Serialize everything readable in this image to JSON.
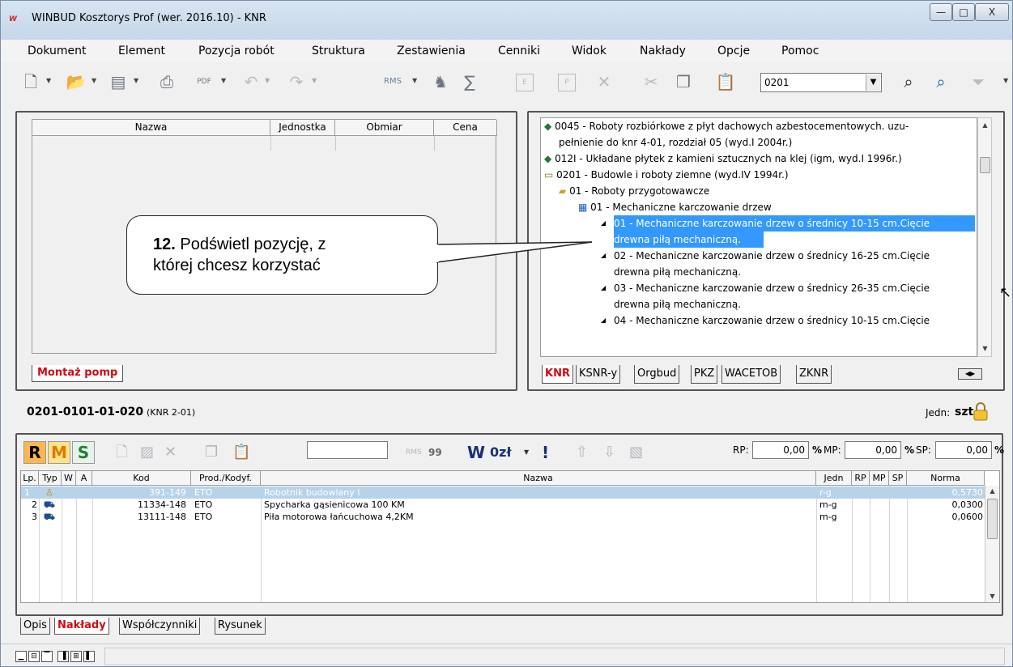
{
  "window": {
    "title": "WINBUD Kosztorys Prof (wer. 2016.10) - KNR",
    "app_icon_letter": "W",
    "min_glyph": "—",
    "max_glyph": "□",
    "close_glyph": "X"
  },
  "menu": [
    {
      "label": "Dokument"
    },
    {
      "label": "Element"
    },
    {
      "label": "Pozycja robót"
    },
    {
      "label": "Struktura"
    },
    {
      "label": "Zestawienia"
    },
    {
      "label": "Cenniki"
    },
    {
      "label": "Widok"
    },
    {
      "label": "Nakłady"
    },
    {
      "label": "Opcje"
    },
    {
      "label": "Pomoc"
    }
  ],
  "toolbar": {
    "code_value": "0201",
    "rms_label": "RMS",
    "pdf_label": "PDF",
    "e_label": "E",
    "p_label": "P"
  },
  "left_panel": {
    "columns": [
      "Nazwa",
      "Jednostka",
      "Obmiar",
      "Cena"
    ],
    "tab_label": "Montaż pomp"
  },
  "tree": {
    "items": [
      {
        "text": "0045 - Roboty rozbiórkowe z płyt dachowych azbestocementowych. uzu-"
      },
      {
        "text": "pełnienie do knr 4-01, rozdział 05 (wyd.I 2004r.)"
      },
      {
        "text": "012I - Układane płytek z kamieni sztucznych na klej (igm, wyd.I 1996r.)"
      },
      {
        "text": "0201 - Budowle i roboty ziemne (wyd.IV 1994r.)"
      },
      {
        "text": "01 - Roboty przygotowawcze"
      },
      {
        "text": "01 - Mechaniczne karczowanie drzew"
      },
      {
        "text": "01 - Mechaniczne karczowanie drzew o średnicy 10-15 cm.Cięcie"
      },
      {
        "text": "drewna piłą mechaniczną."
      },
      {
        "text": "02 - Mechaniczne karczowanie drzew o średnicy 16-25 cm.Cięcie"
      },
      {
        "text": "drewna piłą mechaniczną."
      },
      {
        "text": "03 - Mechaniczne karczowanie drzew o średnicy 26-35 cm.Cięcie"
      },
      {
        "text": "drewna piłą mechaniczną."
      },
      {
        "text": "04 - Mechaniczne karczowanie drzew o średnicy 10-15 cm.Cięcie"
      }
    ],
    "tabs": [
      "KNR",
      "KSNR-y",
      "Orgbud",
      "PKZ",
      "WACETOB",
      "ZKNR"
    ]
  },
  "position": {
    "code": "0201-0101-01-020",
    "catalog": "(KNR 2-01)",
    "unit_label": "Jedn:",
    "unit_value": "szt"
  },
  "bottom_toolbar": {
    "r_label": "R",
    "m_label": "M",
    "s_label": "S",
    "rms_small": "RMS",
    "num_99": "99",
    "w_label": "W",
    "zl_label": "0zł",
    "excl": "!",
    "rp_label": "RP:",
    "rp_value": "0,00",
    "mp_label": "MP:",
    "mp_value": "0,00",
    "sp_label": "SP:",
    "sp_value": "0,00",
    "pct": "%"
  },
  "grid": {
    "columns": [
      "Lp.",
      "Typ",
      "W",
      "A",
      "Kod",
      "Prod./Kodyf.",
      "Nazwa",
      "Jedn",
      "RP",
      "MP",
      "SP",
      "Norma"
    ],
    "rows": [
      {
        "lp": "1",
        "kod": "391-149",
        "prod": "ETO",
        "nazwa": "Robotnik budowlany I",
        "jedn": "r-g",
        "norma": "0,5730"
      },
      {
        "lp": "2",
        "kod": "11334-148",
        "prod": "ETO",
        "nazwa": "Spycharka gąsienicowa 100 KM",
        "jedn": "m-g",
        "norma": "0,0300"
      },
      {
        "lp": "3",
        "kod": "13111-148",
        "prod": "ETO",
        "nazwa": "Piła motorowa łańcuchowa 4,2KM",
        "jedn": "m-g",
        "norma": "0,0600"
      }
    ]
  },
  "bottom_tabs": [
    "Opis",
    "Nakłady",
    "Współczynniki",
    "Rysunek"
  ],
  "callout": {
    "number": "12.",
    "text_line1": "Podświetl pozycję, z",
    "text_line2": "której chcesz korzystać"
  },
  "colors": {
    "selection": "#3399ff",
    "highlight_row": "#b6d3ea",
    "active_tab": "#d10a10"
  }
}
